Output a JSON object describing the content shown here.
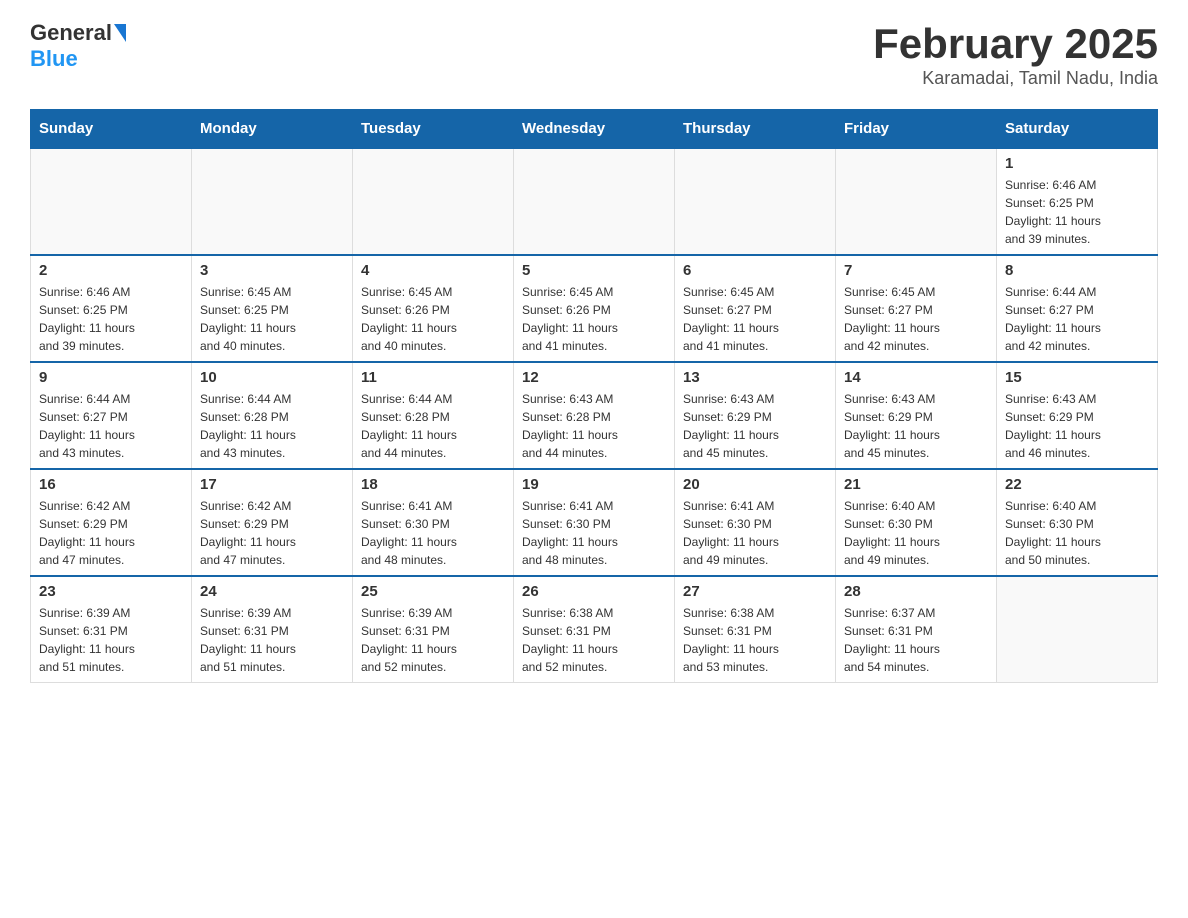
{
  "header": {
    "logo_general": "General",
    "logo_blue": "Blue",
    "month_title": "February 2025",
    "location": "Karamadai, Tamil Nadu, India"
  },
  "weekdays": [
    "Sunday",
    "Monday",
    "Tuesday",
    "Wednesday",
    "Thursday",
    "Friday",
    "Saturday"
  ],
  "weeks": [
    [
      {
        "day": "",
        "info": ""
      },
      {
        "day": "",
        "info": ""
      },
      {
        "day": "",
        "info": ""
      },
      {
        "day": "",
        "info": ""
      },
      {
        "day": "",
        "info": ""
      },
      {
        "day": "",
        "info": ""
      },
      {
        "day": "1",
        "info": "Sunrise: 6:46 AM\nSunset: 6:25 PM\nDaylight: 11 hours\nand 39 minutes."
      }
    ],
    [
      {
        "day": "2",
        "info": "Sunrise: 6:46 AM\nSunset: 6:25 PM\nDaylight: 11 hours\nand 39 minutes."
      },
      {
        "day": "3",
        "info": "Sunrise: 6:45 AM\nSunset: 6:25 PM\nDaylight: 11 hours\nand 40 minutes."
      },
      {
        "day": "4",
        "info": "Sunrise: 6:45 AM\nSunset: 6:26 PM\nDaylight: 11 hours\nand 40 minutes."
      },
      {
        "day": "5",
        "info": "Sunrise: 6:45 AM\nSunset: 6:26 PM\nDaylight: 11 hours\nand 41 minutes."
      },
      {
        "day": "6",
        "info": "Sunrise: 6:45 AM\nSunset: 6:27 PM\nDaylight: 11 hours\nand 41 minutes."
      },
      {
        "day": "7",
        "info": "Sunrise: 6:45 AM\nSunset: 6:27 PM\nDaylight: 11 hours\nand 42 minutes."
      },
      {
        "day": "8",
        "info": "Sunrise: 6:44 AM\nSunset: 6:27 PM\nDaylight: 11 hours\nand 42 minutes."
      }
    ],
    [
      {
        "day": "9",
        "info": "Sunrise: 6:44 AM\nSunset: 6:27 PM\nDaylight: 11 hours\nand 43 minutes."
      },
      {
        "day": "10",
        "info": "Sunrise: 6:44 AM\nSunset: 6:28 PM\nDaylight: 11 hours\nand 43 minutes."
      },
      {
        "day": "11",
        "info": "Sunrise: 6:44 AM\nSunset: 6:28 PM\nDaylight: 11 hours\nand 44 minutes."
      },
      {
        "day": "12",
        "info": "Sunrise: 6:43 AM\nSunset: 6:28 PM\nDaylight: 11 hours\nand 44 minutes."
      },
      {
        "day": "13",
        "info": "Sunrise: 6:43 AM\nSunset: 6:29 PM\nDaylight: 11 hours\nand 45 minutes."
      },
      {
        "day": "14",
        "info": "Sunrise: 6:43 AM\nSunset: 6:29 PM\nDaylight: 11 hours\nand 45 minutes."
      },
      {
        "day": "15",
        "info": "Sunrise: 6:43 AM\nSunset: 6:29 PM\nDaylight: 11 hours\nand 46 minutes."
      }
    ],
    [
      {
        "day": "16",
        "info": "Sunrise: 6:42 AM\nSunset: 6:29 PM\nDaylight: 11 hours\nand 47 minutes."
      },
      {
        "day": "17",
        "info": "Sunrise: 6:42 AM\nSunset: 6:29 PM\nDaylight: 11 hours\nand 47 minutes."
      },
      {
        "day": "18",
        "info": "Sunrise: 6:41 AM\nSunset: 6:30 PM\nDaylight: 11 hours\nand 48 minutes."
      },
      {
        "day": "19",
        "info": "Sunrise: 6:41 AM\nSunset: 6:30 PM\nDaylight: 11 hours\nand 48 minutes."
      },
      {
        "day": "20",
        "info": "Sunrise: 6:41 AM\nSunset: 6:30 PM\nDaylight: 11 hours\nand 49 minutes."
      },
      {
        "day": "21",
        "info": "Sunrise: 6:40 AM\nSunset: 6:30 PM\nDaylight: 11 hours\nand 49 minutes."
      },
      {
        "day": "22",
        "info": "Sunrise: 6:40 AM\nSunset: 6:30 PM\nDaylight: 11 hours\nand 50 minutes."
      }
    ],
    [
      {
        "day": "23",
        "info": "Sunrise: 6:39 AM\nSunset: 6:31 PM\nDaylight: 11 hours\nand 51 minutes."
      },
      {
        "day": "24",
        "info": "Sunrise: 6:39 AM\nSunset: 6:31 PM\nDaylight: 11 hours\nand 51 minutes."
      },
      {
        "day": "25",
        "info": "Sunrise: 6:39 AM\nSunset: 6:31 PM\nDaylight: 11 hours\nand 52 minutes."
      },
      {
        "day": "26",
        "info": "Sunrise: 6:38 AM\nSunset: 6:31 PM\nDaylight: 11 hours\nand 52 minutes."
      },
      {
        "day": "27",
        "info": "Sunrise: 6:38 AM\nSunset: 6:31 PM\nDaylight: 11 hours\nand 53 minutes."
      },
      {
        "day": "28",
        "info": "Sunrise: 6:37 AM\nSunset: 6:31 PM\nDaylight: 11 hours\nand 54 minutes."
      },
      {
        "day": "",
        "info": ""
      }
    ]
  ]
}
